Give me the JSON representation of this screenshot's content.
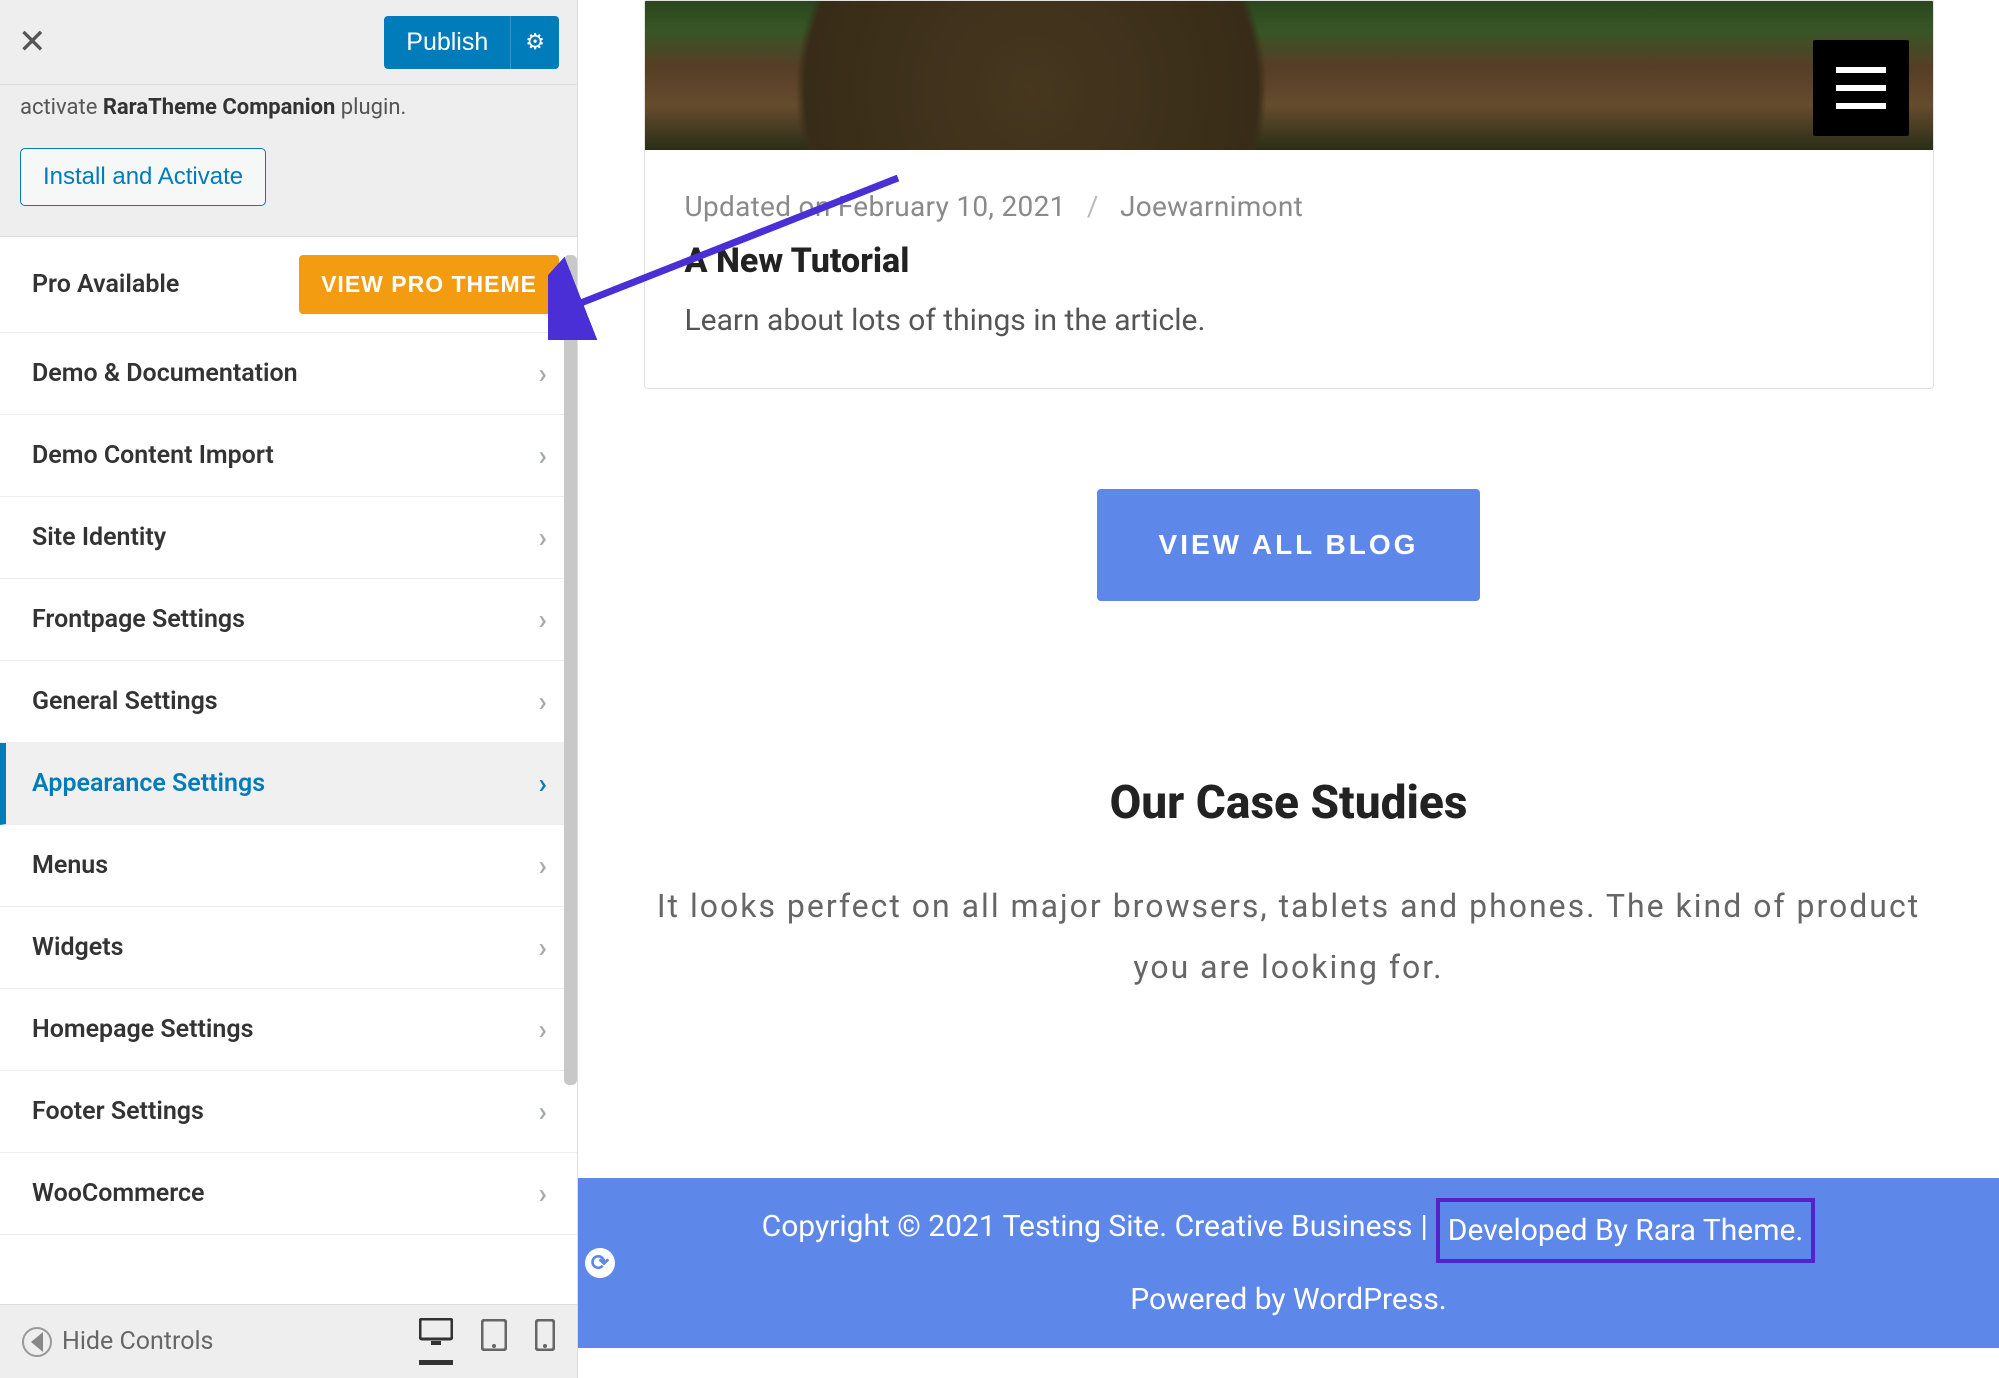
{
  "header": {
    "publish_label": "Publish"
  },
  "notice": {
    "prefix": "activate ",
    "plugin_name": "RaraTheme Companion",
    "suffix": " plugin.",
    "install_label": "Install and Activate"
  },
  "pro": {
    "label": "Pro Available",
    "button": "VIEW PRO THEME"
  },
  "menu": [
    {
      "label": "Demo & Documentation",
      "active": false
    },
    {
      "label": "Demo Content Import",
      "active": false
    },
    {
      "label": "Site Identity",
      "active": false
    },
    {
      "label": "Frontpage Settings",
      "active": false
    },
    {
      "label": "General Settings",
      "active": false
    },
    {
      "label": "Appearance Settings",
      "active": true
    },
    {
      "label": "Menus",
      "active": false
    },
    {
      "label": "Widgets",
      "active": false
    },
    {
      "label": "Homepage Settings",
      "active": false
    },
    {
      "label": "Footer Settings",
      "active": false
    },
    {
      "label": "WooCommerce",
      "active": false
    }
  ],
  "footer_controls": {
    "hide_label": "Hide Controls"
  },
  "post": {
    "meta_updated": "Updated on February 10, 2021",
    "meta_author": "Joewarnimont",
    "title": "A New Tutorial",
    "excerpt": "Learn about lots of things in the article."
  },
  "blog": {
    "view_all": "VIEW ALL BLOG"
  },
  "case": {
    "heading": "Our Case Studies",
    "sub": "It looks perfect on all major browsers, tablets and phones. The kind of product you are looking for."
  },
  "site_footer": {
    "copyright": "Copyright © 2021 Testing Site. Creative Business",
    "bar": "  |  ",
    "developed": "Developed By Rara Theme.",
    "powered": " Powered by WordPress."
  }
}
